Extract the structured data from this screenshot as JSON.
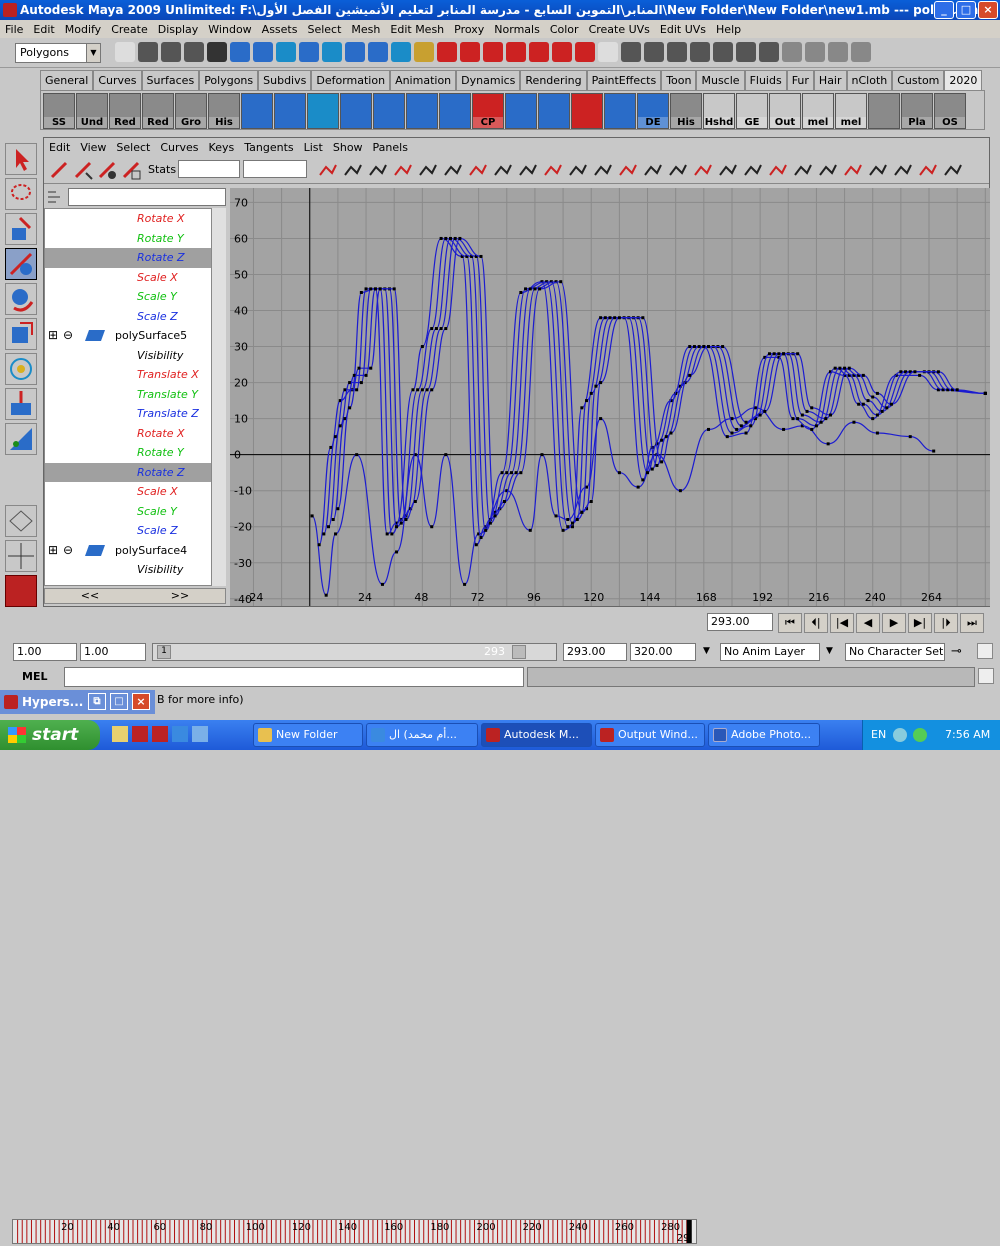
{
  "window": {
    "title": "Autodesk Maya 2009 Unlimited: F:\\المنابر\\التموين السابع - مدرسة المنابر لتعليم الأنميشين الفصل الأول\\New Folder\\New Folder\\new1.mb   ---   polySurfa...",
    "min": "_",
    "max": "□",
    "close": "×"
  },
  "menu": [
    "File",
    "Edit",
    "Modify",
    "Create",
    "Display",
    "Window",
    "Assets",
    "Select",
    "Mesh",
    "Edit Mesh",
    "Proxy",
    "Normals",
    "Color",
    "Create UVs",
    "Edit UVs",
    "Help"
  ],
  "mode_select": "Polygons",
  "shelf_tabs": [
    "General",
    "Curves",
    "Surfaces",
    "Polygons",
    "Subdivs",
    "Deformation",
    "Animation",
    "Dynamics",
    "Rendering",
    "PaintEffects",
    "Toon",
    "Muscle",
    "Fluids",
    "Fur",
    "Hair",
    "nCloth",
    "Custom",
    "2020"
  ],
  "shelf_items": [
    "SS",
    "Und",
    "Red",
    "Red",
    "Gro",
    "His",
    "",
    "",
    "",
    "",
    "",
    "",
    "",
    "CP",
    "",
    "",
    "",
    "",
    "DE",
    "His",
    "Hshd",
    "GE",
    "Out",
    "mel",
    "mel",
    "",
    "Pla",
    "OS"
  ],
  "graph_editor": {
    "menu": [
      "Edit",
      "View",
      "Select",
      "Curves",
      "Keys",
      "Tangents",
      "List",
      "Show",
      "Panels"
    ],
    "stats_label": "Stats",
    "outliner": [
      {
        "label": "Rotate X",
        "color": "#e02020",
        "selected": false,
        "node": false
      },
      {
        "label": "Rotate Y",
        "color": "#10c010",
        "selected": false,
        "node": false
      },
      {
        "label": "Rotate Z",
        "color": "#1a30e0",
        "selected": true,
        "node": false
      },
      {
        "label": "Scale X",
        "color": "#e02020",
        "selected": false,
        "node": false
      },
      {
        "label": "Scale Y",
        "color": "#10c010",
        "selected": false,
        "node": false
      },
      {
        "label": "Scale Z",
        "color": "#1a30e0",
        "selected": false,
        "node": false
      },
      {
        "label": "polySurface5",
        "color": "#000000",
        "selected": false,
        "node": true
      },
      {
        "label": "Visibility",
        "color": "#000000",
        "selected": false,
        "node": false
      },
      {
        "label": "Translate X",
        "color": "#e02020",
        "selected": false,
        "node": false
      },
      {
        "label": "Translate Y",
        "color": "#10c010",
        "selected": false,
        "node": false
      },
      {
        "label": "Translate Z",
        "color": "#1a30e0",
        "selected": false,
        "node": false
      },
      {
        "label": "Rotate X",
        "color": "#e02020",
        "selected": false,
        "node": false
      },
      {
        "label": "Rotate Y",
        "color": "#10c010",
        "selected": false,
        "node": false
      },
      {
        "label": "Rotate Z",
        "color": "#1a30e0",
        "selected": true,
        "node": false
      },
      {
        "label": "Scale X",
        "color": "#e02020",
        "selected": false,
        "node": false
      },
      {
        "label": "Scale Y",
        "color": "#10c010",
        "selected": false,
        "node": false
      },
      {
        "label": "Scale Z",
        "color": "#1a30e0",
        "selected": false,
        "node": false
      },
      {
        "label": "polySurface4",
        "color": "#000000",
        "selected": false,
        "node": true
      },
      {
        "label": "Visibility",
        "color": "#000000",
        "selected": false,
        "node": false
      }
    ],
    "scroll_left": "<<",
    "scroll_right": ">>",
    "y_ticks": [
      "70",
      "60",
      "50",
      "40",
      "30",
      "20",
      "10",
      "0",
      "-10",
      "-20",
      "-30",
      "-40"
    ],
    "x_ticks": [
      "-24",
      "24",
      "48",
      "72",
      "96",
      "120",
      "144",
      "168",
      "192",
      "216",
      "240",
      "264"
    ]
  },
  "timeline": {
    "ticks": [
      "20",
      "40",
      "60",
      "80",
      "100",
      "120",
      "140",
      "160",
      "180",
      "200",
      "220",
      "240",
      "260",
      "280"
    ],
    "current_frame": "293.00",
    "end_marker": "29"
  },
  "range": {
    "start": "1.00",
    "start2": "1.00",
    "slider_start": "1",
    "slider_end": "293",
    "end": "293.00",
    "end2": "320.00",
    "anim_layer": "No Anim Layer",
    "char_set": "No Character Set"
  },
  "cmdline": {
    "label": "MEL",
    "help": "B for more info)"
  },
  "hyper": {
    "label": "Hypers..."
  },
  "taskbar": {
    "start": "start",
    "items": [
      "New Folder",
      "أم محمد) ال...",
      "Autodesk M...",
      "Output Wind...",
      "Adobe Photo..."
    ],
    "lang": "EN",
    "time": "7:56 AM"
  },
  "chart_data": {
    "type": "line",
    "title": "",
    "xlabel": "",
    "ylabel": "",
    "xlim": [
      -34,
      290
    ],
    "ylim": [
      -42,
      74
    ],
    "x_ticks": [
      -24,
      24,
      48,
      72,
      96,
      120,
      144,
      168,
      192,
      216,
      240,
      264
    ],
    "y_ticks": [
      -40,
      -30,
      -20,
      -10,
      0,
      10,
      20,
      30,
      40,
      50,
      60,
      70
    ],
    "series": [
      {
        "values": [
          [
            1,
            -17
          ],
          [
            7,
            -39
          ],
          [
            11,
            -22
          ],
          [
            20,
            0
          ],
          [
            31,
            -36
          ],
          [
            37,
            -27
          ],
          [
            45,
            0
          ],
          [
            52,
            -20
          ],
          [
            58,
            0
          ],
          [
            66,
            -36
          ],
          [
            72,
            -22
          ],
          [
            84,
            -10
          ],
          [
            94,
            -21
          ],
          [
            99,
            0
          ],
          [
            105,
            -17
          ],
          [
            110,
            -18
          ],
          [
            118,
            -9
          ],
          [
            124,
            10
          ],
          [
            132,
            -5
          ],
          [
            140,
            -9
          ],
          [
            148,
            0
          ],
          [
            158,
            -10
          ],
          [
            170,
            7
          ],
          [
            180,
            10
          ],
          [
            190,
            13
          ],
          [
            202,
            7
          ],
          [
            210,
            8
          ],
          [
            221,
            3
          ],
          [
            232,
            9
          ],
          [
            242,
            6
          ],
          [
            256,
            5
          ],
          [
            266,
            1
          ]
        ]
      },
      {
        "values": [
          [
            4,
            -25
          ],
          [
            9,
            2
          ],
          [
            13,
            15
          ],
          [
            18,
            18
          ],
          [
            22,
            45
          ],
          [
            28,
            46
          ],
          [
            33,
            -22
          ],
          [
            37,
            -19
          ],
          [
            44,
            18
          ],
          [
            48,
            30
          ],
          [
            56,
            60
          ],
          [
            65,
            55
          ],
          [
            71,
            -25
          ],
          [
            75,
            -20
          ],
          [
            82,
            -5
          ],
          [
            90,
            45
          ],
          [
            99,
            48
          ],
          [
            108,
            -21
          ],
          [
            112,
            -20
          ],
          [
            116,
            13
          ],
          [
            124,
            38
          ],
          [
            134,
            38
          ],
          [
            142,
            -7
          ],
          [
            146,
            2
          ],
          [
            154,
            15
          ],
          [
            162,
            30
          ],
          [
            168,
            30
          ],
          [
            178,
            5
          ],
          [
            186,
            6
          ],
          [
            194,
            27
          ],
          [
            200,
            27
          ],
          [
            206,
            10
          ],
          [
            214,
            7
          ],
          [
            222,
            23
          ],
          [
            228,
            22
          ],
          [
            234,
            14
          ],
          [
            240,
            10
          ],
          [
            250,
            22
          ],
          [
            260,
            22
          ],
          [
            268,
            18
          ],
          [
            288,
            17
          ]
        ]
      },
      {
        "values": [
          [
            6,
            -22
          ],
          [
            11,
            5
          ],
          [
            15,
            18
          ],
          [
            20,
            18
          ],
          [
            24,
            46
          ],
          [
            30,
            46
          ],
          [
            35,
            -22
          ],
          [
            39,
            -18
          ],
          [
            46,
            18
          ],
          [
            52,
            35
          ],
          [
            58,
            60
          ],
          [
            67,
            55
          ],
          [
            73,
            -23
          ],
          [
            77,
            -18
          ],
          [
            84,
            -5
          ],
          [
            92,
            46
          ],
          [
            101,
            48
          ],
          [
            110,
            -20
          ],
          [
            114,
            -18
          ],
          [
            118,
            15
          ],
          [
            126,
            38
          ],
          [
            136,
            38
          ],
          [
            144,
            -5
          ],
          [
            148,
            3
          ],
          [
            156,
            17
          ],
          [
            164,
            30
          ],
          [
            170,
            30
          ],
          [
            180,
            6
          ],
          [
            188,
            8
          ],
          [
            196,
            28
          ],
          [
            202,
            28
          ],
          [
            208,
            10
          ],
          [
            216,
            8
          ],
          [
            224,
            24
          ],
          [
            230,
            22
          ],
          [
            236,
            14
          ],
          [
            242,
            11
          ],
          [
            252,
            23
          ],
          [
            262,
            23
          ],
          [
            270,
            18
          ],
          [
            288,
            17
          ]
        ]
      },
      {
        "values": [
          [
            8,
            -20
          ],
          [
            13,
            8
          ],
          [
            17,
            20
          ],
          [
            22,
            20
          ],
          [
            26,
            46
          ],
          [
            32,
            46
          ],
          [
            37,
            -20
          ],
          [
            41,
            -17
          ],
          [
            48,
            18
          ],
          [
            54,
            35
          ],
          [
            60,
            60
          ],
          [
            69,
            55
          ],
          [
            75,
            -21
          ],
          [
            79,
            -16
          ],
          [
            86,
            -5
          ],
          [
            94,
            46
          ],
          [
            103,
            48
          ],
          [
            112,
            -19
          ],
          [
            116,
            -16
          ],
          [
            120,
            17
          ],
          [
            128,
            38
          ],
          [
            138,
            38
          ],
          [
            146,
            -4
          ],
          [
            150,
            4
          ],
          [
            158,
            19
          ],
          [
            166,
            30
          ],
          [
            172,
            30
          ],
          [
            182,
            7
          ],
          [
            190,
            10
          ],
          [
            198,
            28
          ],
          [
            204,
            28
          ],
          [
            210,
            11
          ],
          [
            218,
            9
          ],
          [
            226,
            24
          ],
          [
            232,
            22
          ],
          [
            238,
            15
          ],
          [
            244,
            12
          ],
          [
            254,
            23
          ],
          [
            264,
            23
          ],
          [
            272,
            18
          ],
          [
            288,
            17
          ]
        ]
      },
      {
        "values": [
          [
            10,
            -18
          ],
          [
            15,
            10
          ],
          [
            19,
            22
          ],
          [
            24,
            22
          ],
          [
            28,
            46
          ],
          [
            34,
            46
          ],
          [
            39,
            -19
          ],
          [
            43,
            -15
          ],
          [
            50,
            18
          ],
          [
            56,
            35
          ],
          [
            62,
            60
          ],
          [
            71,
            55
          ],
          [
            77,
            -19
          ],
          [
            81,
            -15
          ],
          [
            88,
            -5
          ],
          [
            96,
            46
          ],
          [
            105,
            48
          ],
          [
            114,
            -18
          ],
          [
            118,
            -15
          ],
          [
            122,
            19
          ],
          [
            130,
            38
          ],
          [
            140,
            38
          ],
          [
            148,
            -3
          ],
          [
            152,
            5
          ],
          [
            160,
            20
          ],
          [
            168,
            30
          ],
          [
            174,
            30
          ],
          [
            184,
            8
          ],
          [
            192,
            11
          ],
          [
            200,
            28
          ],
          [
            206,
            28
          ],
          [
            212,
            12
          ],
          [
            220,
            10
          ],
          [
            228,
            24
          ],
          [
            234,
            22
          ],
          [
            240,
            16
          ],
          [
            246,
            13
          ],
          [
            256,
            23
          ],
          [
            266,
            23
          ],
          [
            274,
            18
          ],
          [
            288,
            17
          ]
        ]
      },
      {
        "values": [
          [
            12,
            -15
          ],
          [
            17,
            13
          ],
          [
            21,
            24
          ],
          [
            26,
            24
          ],
          [
            30,
            46
          ],
          [
            36,
            46
          ],
          [
            41,
            -18
          ],
          [
            45,
            -13
          ],
          [
            52,
            18
          ],
          [
            58,
            35
          ],
          [
            64,
            60
          ],
          [
            73,
            55
          ],
          [
            79,
            -17
          ],
          [
            83,
            -13
          ],
          [
            90,
            -5
          ],
          [
            98,
            46
          ],
          [
            107,
            48
          ],
          [
            116,
            -16
          ],
          [
            120,
            -13
          ],
          [
            124,
            20
          ],
          [
            132,
            38
          ],
          [
            142,
            38
          ],
          [
            150,
            -2
          ],
          [
            154,
            6
          ],
          [
            162,
            22
          ],
          [
            170,
            30
          ],
          [
            176,
            30
          ],
          [
            186,
            9
          ],
          [
            194,
            12
          ],
          [
            202,
            28
          ],
          [
            208,
            28
          ],
          [
            214,
            13
          ],
          [
            222,
            11
          ],
          [
            230,
            24
          ],
          [
            236,
            22
          ],
          [
            242,
            17
          ],
          [
            248,
            14
          ],
          [
            258,
            23
          ],
          [
            268,
            23
          ],
          [
            276,
            18
          ],
          [
            288,
            17
          ]
        ]
      }
    ]
  }
}
